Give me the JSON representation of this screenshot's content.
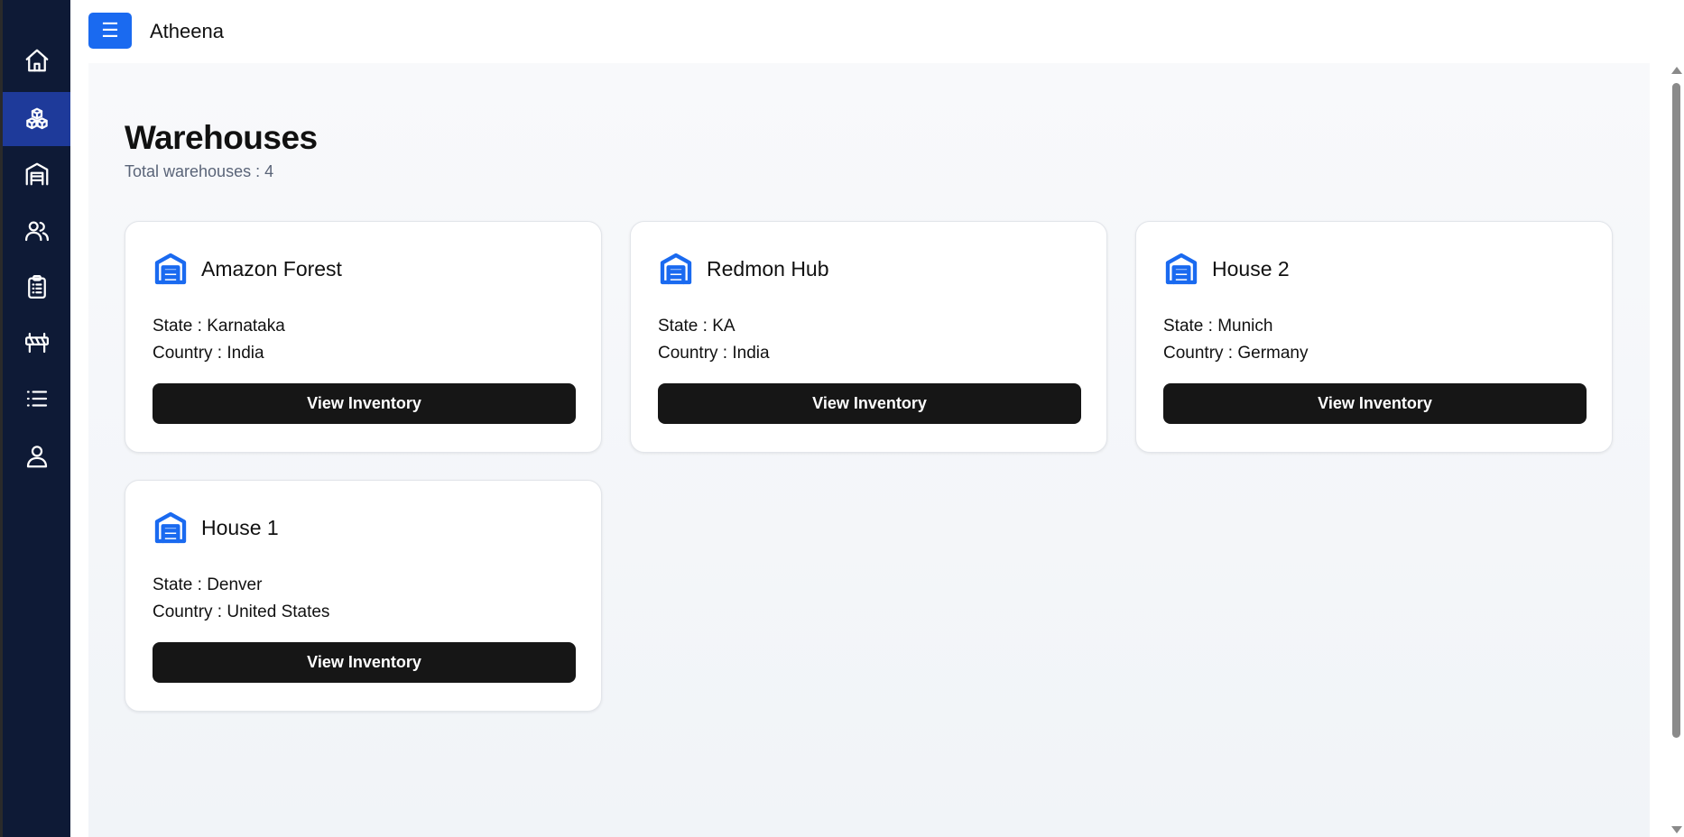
{
  "app": {
    "title": "Atheena",
    "menu_glyph": "☰"
  },
  "sidebar": {
    "items": [
      {
        "id": "home",
        "icon": "home-icon",
        "active": false
      },
      {
        "id": "products",
        "icon": "cubes-icon",
        "active": true
      },
      {
        "id": "warehouses",
        "icon": "warehouse-icon",
        "active": false
      },
      {
        "id": "users",
        "icon": "users-icon",
        "active": false
      },
      {
        "id": "orders",
        "icon": "clipboard-icon",
        "active": false
      },
      {
        "id": "roadblock",
        "icon": "barrier-icon",
        "active": false
      },
      {
        "id": "lists",
        "icon": "list-icon",
        "active": false
      },
      {
        "id": "profile",
        "icon": "user-icon",
        "active": false
      }
    ]
  },
  "page": {
    "title": "Warehouses",
    "subtitle": "Total warehouses : 4"
  },
  "warehouses": [
    {
      "name": "Amazon Forest",
      "state": "State : Karnataka",
      "country": "Country : India",
      "button": "View Inventory"
    },
    {
      "name": "Redmon Hub",
      "state": "State : KA",
      "country": "Country : India",
      "button": "View Inventory"
    },
    {
      "name": "House 2",
      "state": "State : Munich",
      "country": "Country : Germany",
      "button": "View Inventory"
    },
    {
      "name": "House 1",
      "state": "State : Denver",
      "country": "Country : United States",
      "button": "View Inventory"
    }
  ],
  "colors": {
    "sidebar_bg": "#0e1a36",
    "sidebar_active": "#1e3a9a",
    "accent": "#1a6af0",
    "button_dark": "#161616"
  }
}
